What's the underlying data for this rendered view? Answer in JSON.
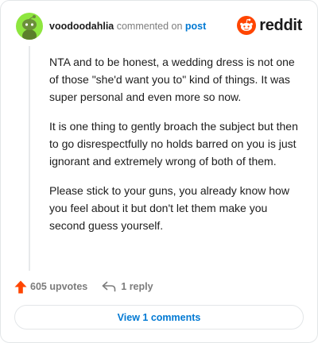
{
  "comment": {
    "username": "voodoodahlia",
    "action_text": "commented on",
    "post_link": "post",
    "brand": "reddit",
    "paragraphs": [
      "NTA and to be honest, a wedding dress is not one of those \"she'd want you to\" kind of things. It was super personal and even more so now.",
      "It is one thing to gently broach the subject but then to go disrespectfully no holds barred on you is just ignorant and extremely wrong of both of them.",
      "Please stick to your guns, you already know how you feel about it but don't let them make you second guess yourself."
    ]
  },
  "actions": {
    "upvotes": "605 upvotes",
    "replies": "1 reply"
  },
  "footer": {
    "view_comments": "View 1 comments"
  },
  "colors": {
    "avatar_bg": "#8ee63f",
    "reddit_orange": "#ff4500",
    "link_blue": "#0079d3"
  }
}
